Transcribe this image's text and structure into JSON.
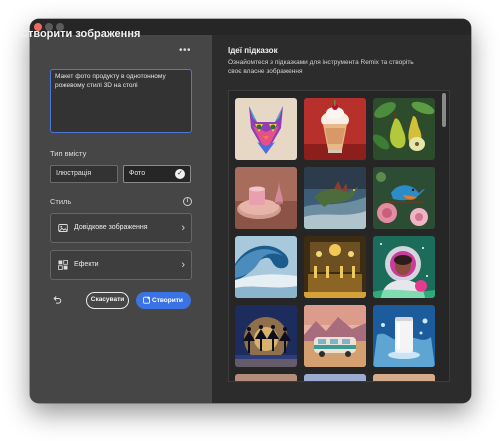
{
  "dialog": {
    "title": "Створити зображення",
    "prompt_value": "Макет фото продукту в однотонному рожевому стилі 3D на столі",
    "content_type": {
      "label": "Тип вмісту",
      "options": [
        {
          "label": "Ілюстрація",
          "selected": false
        },
        {
          "label": "Фото",
          "selected": true
        }
      ]
    },
    "style": {
      "label": "Стиль",
      "cards": [
        {
          "label": "Довідкове зображення",
          "icon": "image-icon"
        },
        {
          "label": "Ефекти",
          "icon": "effects-grid-icon"
        }
      ]
    },
    "buttons": {
      "cancel": "Скасувати",
      "create": "Створити"
    }
  },
  "ideas": {
    "title": "Ідеї підказок",
    "description": "Ознайомтеся з підказками для інструмента Remix та створіть своє власне зображення",
    "thumbnails": [
      {
        "subject": "colorful geometric cat",
        "accent": "#c84fd0"
      },
      {
        "subject": "milkshake with whipped cream",
        "accent": "#d24a3e"
      },
      {
        "subject": "green pears with leaves",
        "accent": "#9bbf3a"
      },
      {
        "subject": "pink product mockup on table",
        "accent": "#d4a08c"
      },
      {
        "subject": "dinosaur on stormy shore",
        "accent": "#5f8fb0"
      },
      {
        "subject": "bird on roses",
        "accent": "#e4809c"
      },
      {
        "subject": "ocean wave",
        "accent": "#4e86b8"
      },
      {
        "subject": "golden luxury interior",
        "accent": "#d4a038"
      },
      {
        "subject": "astronaut in neon space",
        "accent": "#c83c9c"
      },
      {
        "subject": "dancers silhouettes on stage",
        "accent": "#f0a840"
      },
      {
        "subject": "retro camper van in desert",
        "accent": "#c0906c"
      },
      {
        "subject": "white can splash",
        "accent": "#2c7cc0"
      },
      {
        "subject": "partially visible thumbnail",
        "accent": "#8c6c5c"
      },
      {
        "subject": "partially visible thumbnail",
        "accent": "#7c8cb4"
      },
      {
        "subject": "partially visible thumbnail",
        "accent": "#b48c6c"
      }
    ]
  },
  "colors": {
    "accent": "#3b73e4",
    "left_panel": "#464646",
    "right_panel": "#2c2c2c",
    "close_button": "#ed6a5e"
  }
}
